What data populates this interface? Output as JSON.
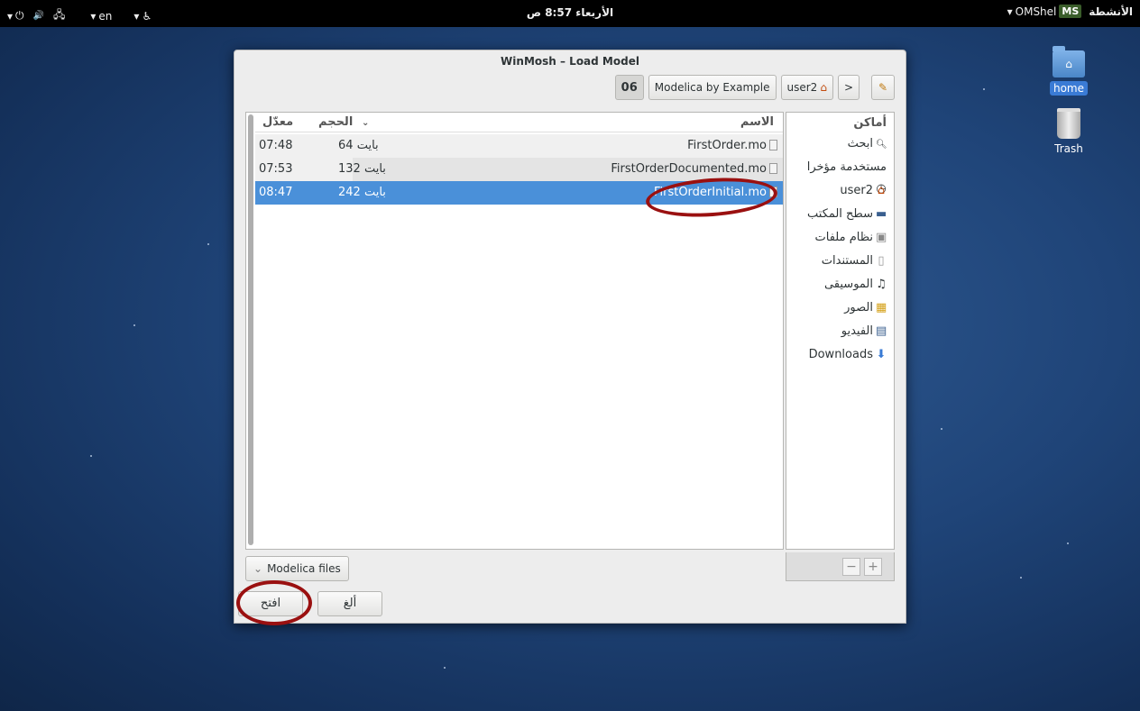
{
  "topbar": {
    "power": "⏻",
    "volume": "🔊",
    "network": "🖧",
    "lang": "en",
    "accessibility": "♿",
    "clock": "الأربعاء 8:57 ص",
    "app_badge": "MS",
    "app_name": "OMShel",
    "activities": "الأنشطة"
  },
  "desktop": {
    "home_label": "home",
    "trash_label": "Trash"
  },
  "dialog": {
    "title": "WinMosh – Load Model",
    "path": [
      "06",
      "Modelica by Example",
      "user2"
    ],
    "nav_next": ">",
    "columns": {
      "name": "الاسم",
      "size": "الحجم",
      "modified": "معدّل"
    },
    "files": [
      {
        "name": "FirstOrder.mo",
        "size": "64 بايت",
        "modified": "07:48"
      },
      {
        "name": "FirstOrderDocumented.mo",
        "size": "132 بايت",
        "modified": "07:53"
      },
      {
        "name": "FirstOrderInitial.mo",
        "size": "242 بايت",
        "modified": "08:47"
      }
    ],
    "places_header": "أماكن",
    "places": [
      {
        "label": "ابحث",
        "icon": "🔍"
      },
      {
        "label": "مستخدمة مؤخرا",
        "icon": "🕓"
      },
      {
        "label": "user2",
        "icon": "⌂"
      },
      {
        "label": "سطح المكتب",
        "icon": "▬"
      },
      {
        "label": "نظام ملفات",
        "icon": "▣"
      },
      {
        "label": "المستندات",
        "icon": "▯"
      },
      {
        "label": "الموسيقى",
        "icon": "♫"
      },
      {
        "label": "الصور",
        "icon": "▦"
      },
      {
        "label": "الفيديو",
        "icon": "▤"
      },
      {
        "label": "Downloads",
        "icon": "⬇"
      }
    ],
    "places_remove": "−",
    "places_add": "+",
    "filter": "Modelica files",
    "cancel": "ألغ",
    "open": "افتح"
  }
}
